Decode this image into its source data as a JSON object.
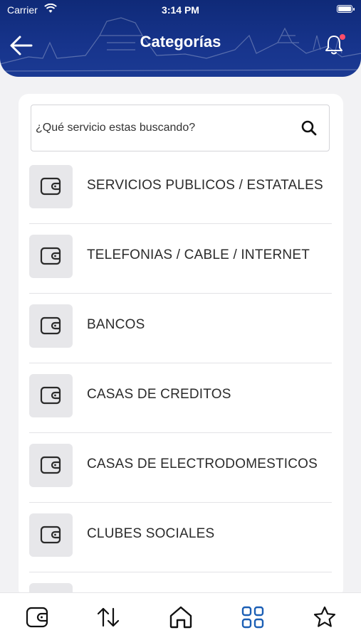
{
  "status_bar": {
    "carrier": "Carrier",
    "time": "3:14 PM"
  },
  "header": {
    "title": "Categorías"
  },
  "search": {
    "placeholder": "¿Qué servicio estas buscando?"
  },
  "categories": [
    {
      "label": "SERVICIOS PUBLICOS / ESTATALES",
      "icon": "wallet-icon"
    },
    {
      "label": "TELEFONIAS / CABLE / INTERNET",
      "icon": "wallet-icon"
    },
    {
      "label": "BANCOS",
      "icon": "wallet-icon"
    },
    {
      "label": "CASAS DE CREDITOS",
      "icon": "wallet-icon"
    },
    {
      "label": "CASAS DE ELECTRODOMESTICOS",
      "icon": "wallet-icon"
    },
    {
      "label": "CLUBES SOCIALES",
      "icon": "wallet-icon"
    },
    {
      "label": "",
      "icon": "wallet-icon"
    }
  ],
  "tabbar": {
    "items": [
      {
        "icon": "wallet-icon",
        "active": false
      },
      {
        "icon": "transfer-arrows-icon",
        "active": false
      },
      {
        "icon": "home-icon",
        "active": false
      },
      {
        "icon": "grid-icon",
        "active": true
      },
      {
        "icon": "star-icon",
        "active": false
      }
    ]
  },
  "colors": {
    "header_bg": "#17348c",
    "accent": "#1b5fb5",
    "notification_dot": "#ff4d6a",
    "icon_box_bg": "#e7e7ea"
  }
}
